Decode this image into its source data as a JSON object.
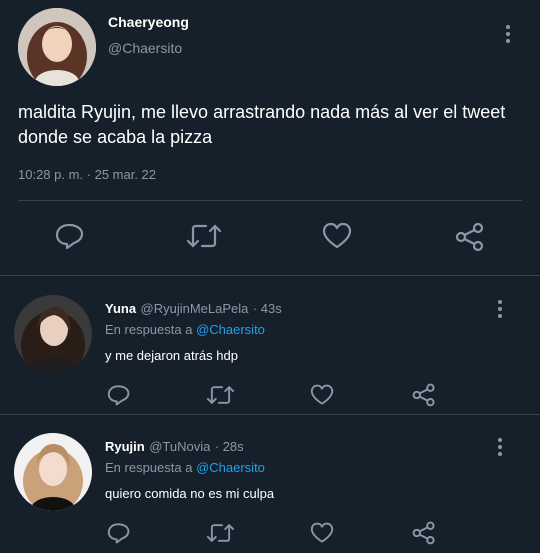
{
  "main_tweet": {
    "author": {
      "name": "Chaeryeong",
      "handle": "@Chaersito"
    },
    "text": "maldita Ryujin, me llevo arrastrando nada más al ver el tweet donde se acaba la pizza",
    "timestamp": "10:28 p. m. · 25 mar. 22"
  },
  "replies": [
    {
      "name": "Yuna",
      "handle": "@RyujinMeLaPela",
      "time": "· 43s",
      "reply_prefix": "En respuesta a",
      "reply_to": "@Chaersito",
      "text": "y me dejaron atrás hdp"
    },
    {
      "name": "Ryujin",
      "handle": "@TuNovia",
      "time": "· 28s",
      "reply_prefix": "En respuesta a",
      "reply_to": "@Chaersito",
      "text": "quiero comida no es mi culpa"
    }
  ],
  "icons": {
    "reply": "comment-icon",
    "retweet": "retweet-icon",
    "like": "heart-icon",
    "share": "share-icon",
    "more": "more-vertical-icon"
  },
  "colors": {
    "background": "#15202b",
    "secondary_text": "#8899a6",
    "link": "#1da1f2",
    "divider": "#38444d"
  }
}
